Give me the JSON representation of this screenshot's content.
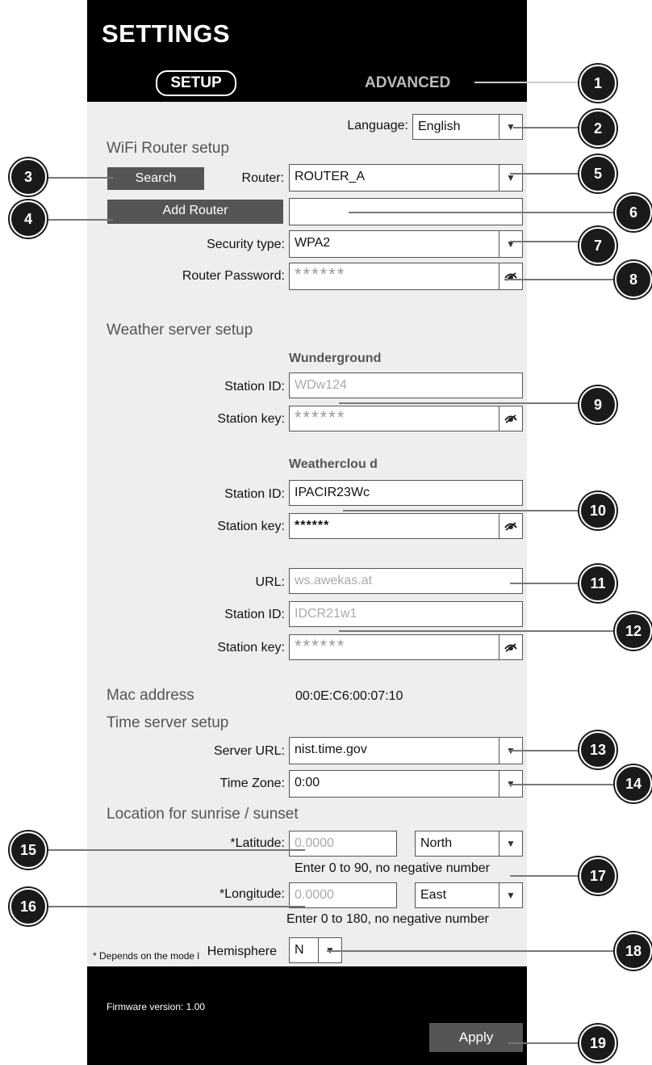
{
  "header": {
    "title": "SETTINGS",
    "tab_setup": "SETUP",
    "tab_advanced": "ADVANCED"
  },
  "language": {
    "label": "Language:",
    "value": "English"
  },
  "wifi": {
    "section": "WiFi Router setup",
    "search_label": "Search",
    "router_label": "Router:",
    "router_value": "ROUTER_A",
    "add_router_label": "Add Router",
    "add_router_value": "",
    "security_label": "Security type:",
    "security_value": "WPA2",
    "password_label": "Router Password:",
    "password_value": "******"
  },
  "weather": {
    "section": "Weather server setup",
    "wunderground": {
      "title": "Wunderground",
      "station_id_label": "Station ID:",
      "station_id_value": "WDw124",
      "station_key_label": "Station key:",
      "station_key_value": "******"
    },
    "weathercloud": {
      "title": "Weatherclou d",
      "station_id_label": "Station ID:",
      "station_id_value": "IPACIR23Wc",
      "station_key_label": "Station key:",
      "station_key_value": "******"
    },
    "awekas": {
      "url_label": "URL:",
      "url_value": "ws.awekas.at",
      "station_id_label": "Station ID:",
      "station_id_value": "IDCR21w1",
      "station_key_label": "Station key:",
      "station_key_value": "******"
    }
  },
  "mac": {
    "label": "Mac address",
    "value": "00:0E:C6:00:07:10"
  },
  "time": {
    "section": "Time server setup",
    "server_label": "Server URL:",
    "server_value": "nist.time.gov",
    "zone_label": "Time Zone:",
    "zone_value": "0:00"
  },
  "location": {
    "section": "Location for sunrise / sunset",
    "lat_label": "*Latitude:",
    "lat_value": "0.0000",
    "lat_dir": "North",
    "lat_hint": "Enter 0 to 90, no negative number",
    "lon_label": "*Longitude:",
    "lon_value": "0.0000",
    "lon_dir": "East",
    "lon_hint": "Enter 0 to 180, no negative number",
    "hemisphere_label": "Hemisphere",
    "hemisphere_value": "N",
    "footnote": "* Depends on the mode l"
  },
  "footer": {
    "firmware": "Firmware version: 1.00",
    "apply_label": "Apply"
  },
  "callouts": [
    "1",
    "2",
    "3",
    "4",
    "5",
    "6",
    "7",
    "8",
    "9",
    "10",
    "11",
    "12",
    "13",
    "14",
    "15",
    "16",
    "17",
    "18",
    "19"
  ],
  "icons": {
    "dropdown": "dropdown-arrow-icon",
    "eye": "eye-hidden-icon"
  },
  "colors": {
    "header": "#000000",
    "panel": "#eeeeee",
    "button": "#555555",
    "callout": "#1a1a1a"
  }
}
